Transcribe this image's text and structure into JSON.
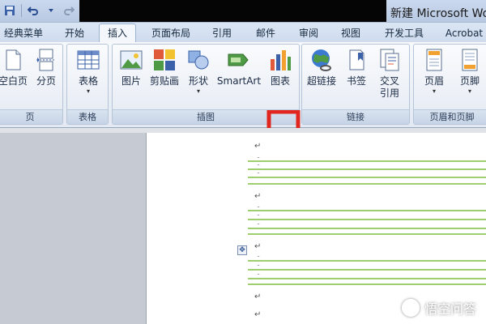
{
  "window": {
    "title": "新建 Microsoft Word"
  },
  "tabs": [
    {
      "label": "经典菜单"
    },
    {
      "label": "开始"
    },
    {
      "label": "插入",
      "active": true
    },
    {
      "label": "页面布局"
    },
    {
      "label": "引用"
    },
    {
      "label": "邮件"
    },
    {
      "label": "审阅"
    },
    {
      "label": "视图"
    },
    {
      "label": "开发工具"
    },
    {
      "label": "Acrobat"
    }
  ],
  "ribbon": {
    "groups": {
      "pages": "页",
      "tables": "表格",
      "illustrations": "插图",
      "links": "链接",
      "header_footer": "页眉和页脚"
    },
    "buttons": {
      "blank_page": "空白页",
      "page_break": "分页",
      "table": "表格",
      "picture": "图片",
      "clip_art": "剪贴画",
      "shapes": "形状",
      "smartart": "SmartArt",
      "chart": "图表",
      "hyperlink": "超链接",
      "bookmark": "书签",
      "cross_reference_line1": "交叉",
      "cross_reference_line2": "引用",
      "header": "页眉",
      "footer": "页脚"
    },
    "dropdown_glyph": "▾"
  },
  "document": {
    "paragraph_mark": "↵",
    "line_mark": "ˉ",
    "anchor_glyph": "✥"
  },
  "watermark": {
    "text": "悟空问答"
  },
  "colors": {
    "underline_green": "#9fce6f",
    "annotation_red": "#e0261e",
    "ribbon_blue": "#d9e3f0"
  }
}
